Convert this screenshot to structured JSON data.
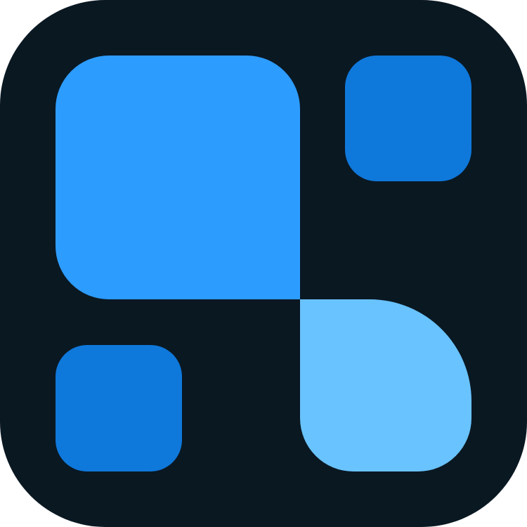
{
  "icon": {
    "name": "app-icon",
    "colors": {
      "background": "#0A1822",
      "primary_blue": "#2D9CFF",
      "dark_blue": "#0F78DB",
      "light_blue": "#69C3FF"
    },
    "shapes": [
      {
        "name": "rounded-square-large",
        "color_key": "primary_blue"
      },
      {
        "name": "rounded-square-small",
        "color_key": "dark_blue"
      },
      {
        "name": "rounded-square-small",
        "color_key": "dark_blue"
      },
      {
        "name": "rounded-square-large",
        "color_key": "light_blue"
      }
    ]
  }
}
